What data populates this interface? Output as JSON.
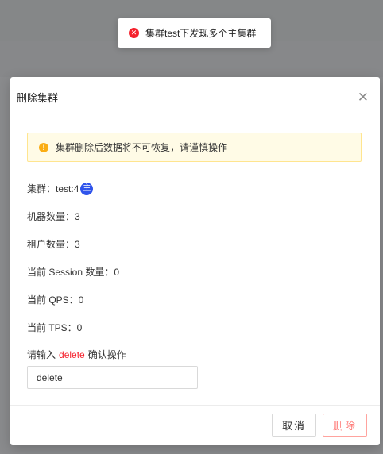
{
  "toast": {
    "message": "集群test下发现多个主集群",
    "icon": "error-circle-icon"
  },
  "modal": {
    "title": "删除集群",
    "alert": "集群删除后数据将不可恢复，请谨慎操作",
    "cluster_label": "集群：",
    "cluster_value": "test:4",
    "master_badge": "主",
    "machines": "机器数量：3",
    "tenants": "租户数量：3",
    "sessions": "当前 Session 数量：0",
    "qps": "当前 QPS：0",
    "tps": "当前 TPS：0",
    "prompt_prefix": "请输入",
    "prompt_keyword": "delete",
    "prompt_suffix": "确认操作",
    "input_value": "delete",
    "cancel": "取消",
    "delete": "删除"
  },
  "colors": {
    "danger": "#f5222d",
    "warning": "#faad14",
    "master_badge": "#2f54eb"
  }
}
